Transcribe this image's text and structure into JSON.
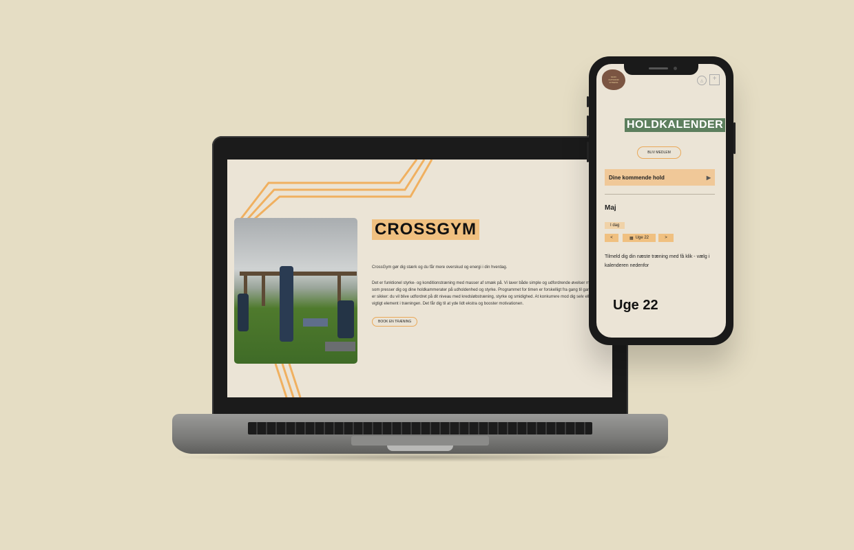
{
  "laptop_page": {
    "headline": "CROSSGYM",
    "intro": "CrossGym gør dig stærk og du får mere overskud og energi i din hverdag.",
    "body": "Det er funktionel styrke- og konditionstræning med masser af smæk på. Vi laver både simple og udfordrende øvelser med variation, som presser dig og dine holdkammerater på udholdenhed og styrke. Programmet for timen er forskelligt fra gang til gang, men én ting er sikker: du vil blive udfordret på dit niveau med kredsløbstræning, styrke og smidighed. At konkurrere mod dig selv eller andre er et vigtigt element i træningen. Det får dig til at yde lidt ekstra og booster motivationen.",
    "book_button": "BOOK EN TRÆNING",
    "colors": {
      "accent": "#f0c080",
      "background": "#ebe4d6",
      "stripe": "#f0b060"
    }
  },
  "phone_page": {
    "logo_text": "SKOV\nOUTDOOR\nFITNESS",
    "user_icon": "user-icon",
    "menu_icon": "menu-icon",
    "title": "HOLDKALENDER",
    "member_button": "BLIV MEDLEM",
    "upcoming_label": "Dine kommende hold",
    "upcoming_arrow": "▶",
    "month": "Maj",
    "today_button": "I dag",
    "prev_button": "<",
    "week_button": "Uge 22",
    "next_button": ">",
    "hint": "Tilmeld dig din næste træning med få klik - vælg i kalenderen nedenfor",
    "week_heading": "Uge 22",
    "colors": {
      "title_bg": "#5d7f5e",
      "accent": "#f0c080",
      "upcoming_bg": "#f0c898"
    }
  }
}
